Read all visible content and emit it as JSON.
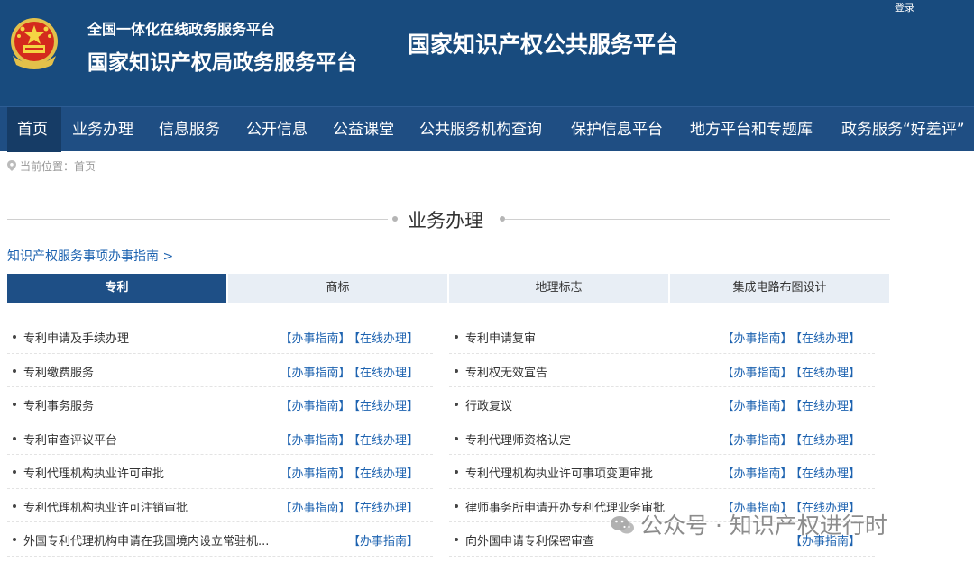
{
  "header": {
    "sub_title": "全国一体化在线政务服务平台",
    "main_title": "国家知识产权局政务服务平台",
    "public_title": "国家知识产权公共服务平台",
    "login": "登录",
    "emblem_icon": "national-emblem-icon"
  },
  "nav": {
    "items": [
      {
        "label": "首页"
      },
      {
        "label": "业务办理"
      },
      {
        "label": "信息服务"
      },
      {
        "label": "公开信息"
      },
      {
        "label": "公益课堂"
      },
      {
        "label": "公共服务机构查询"
      },
      {
        "label": "保护信息平台"
      },
      {
        "label": "地方平台和专题库"
      },
      {
        "label": "政务服务“好差评”"
      }
    ],
    "active": "首页"
  },
  "breadcrumb": {
    "text": "当前位置：首页",
    "icon": "location-pin-icon"
  },
  "section": {
    "title": "业务办理"
  },
  "guide_link": "知识产权服务事项办事指南 >",
  "tabs": [
    {
      "label": "专利"
    },
    {
      "label": "商标"
    },
    {
      "label": "地理标志"
    },
    {
      "label": "集成电路布图设计"
    }
  ],
  "active_tab": "专利",
  "actions": {
    "guide": "【办事指南】",
    "online": "【在线办理】"
  },
  "left_items": [
    {
      "label": "专利申请及手续办理"
    },
    {
      "label": "专利缴费服务"
    },
    {
      "label": "专利事务服务"
    },
    {
      "label": "专利审查评议平台"
    },
    {
      "label": "专利代理机构执业许可审批"
    },
    {
      "label": "专利代理机构执业许可注销审批"
    },
    {
      "label": "外国专利代理机构申请在我国境内设立常驻机..."
    }
  ],
  "right_items": [
    {
      "label": "专利申请复审"
    },
    {
      "label": "专利权无效宣告"
    },
    {
      "label": "行政复议"
    },
    {
      "label": "专利代理师资格认定"
    },
    {
      "label": "专利代理机构执业许可事项变更审批"
    },
    {
      "label": "律师事务所申请开办专利代理业务审批"
    },
    {
      "label": "向外国申请专利保密审查"
    }
  ],
  "watermark": {
    "text": "公众号 · 知识产权进行时",
    "icon": "wechat-icon"
  },
  "colors": {
    "header_bg": "#184b7e",
    "nav_bg": "#1f4e83",
    "link": "#1e63b0",
    "tab_active": "#1e4f86",
    "tab_bg": "#e8eef5"
  }
}
